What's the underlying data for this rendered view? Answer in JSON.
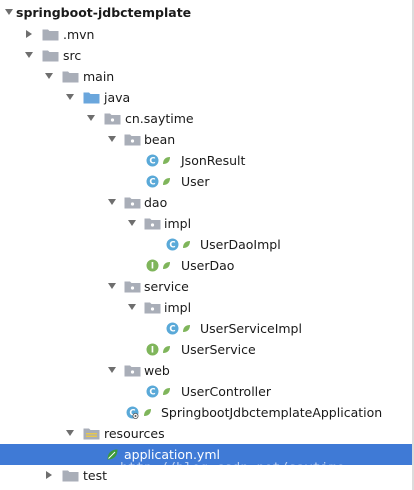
{
  "project_tree": {
    "root": "springboot-jdbctemplate",
    "mvn": ".mvn",
    "src": "src",
    "main": "main",
    "java": "java",
    "package": "cn.saytime",
    "bean": "bean",
    "json_result": "JsonResult",
    "user": "User",
    "dao": "dao",
    "dao_impl": "impl",
    "user_dao_impl": "UserDaoImpl",
    "user_dao": "UserDao",
    "service": "service",
    "service_impl": "impl",
    "user_service_impl": "UserServiceImpl",
    "user_service": "UserService",
    "web": "web",
    "user_controller": "UserController",
    "app_class": "SpringbootJdbctemplateApplication",
    "resources": "resources",
    "app_yml": "application.yml",
    "test": "test"
  },
  "watermark": "http://blog.csdn.net/saytime",
  "colors": {
    "selection": "#3f7ad6",
    "folder": "#a9aeb8",
    "java_folder": "#6aa6dc",
    "class_icon": "#5aa9d8",
    "interface_icon": "#7fb55b",
    "spring_leaf": "#3c9a3c"
  }
}
